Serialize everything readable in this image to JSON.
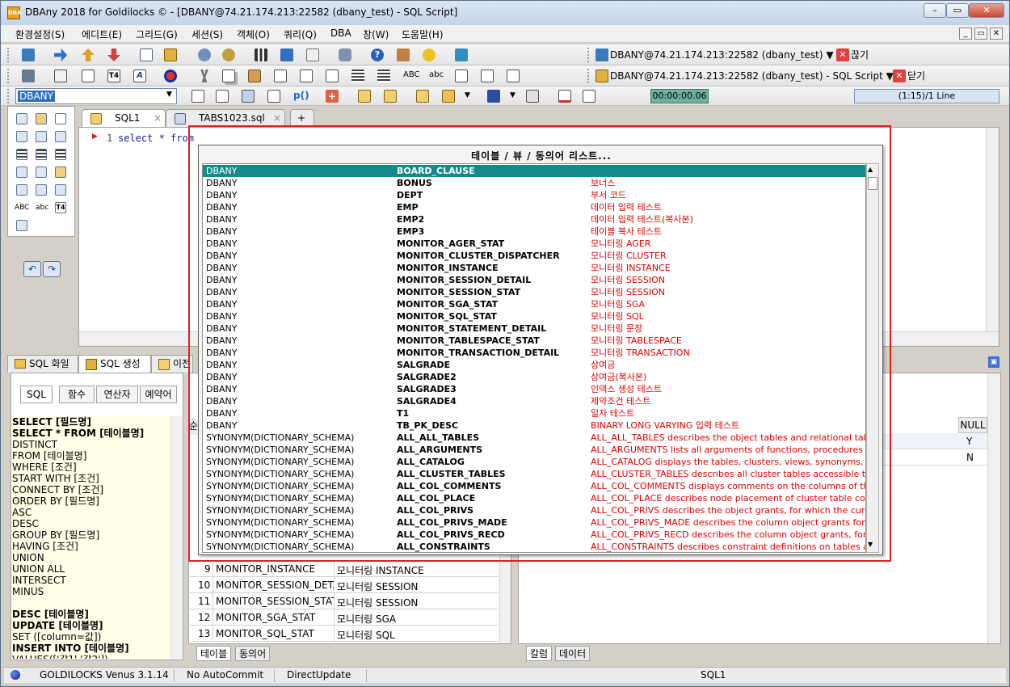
{
  "window": {
    "title": "DBAny 2018 for Goldilocks © - [DBANY@74.21.174.213:22582 (dbany_test) - SQL Script]",
    "icon_text": "DBA"
  },
  "menu": [
    "환경설정(S)",
    "에디트(E)",
    "그리드(G)",
    "세션(S)",
    "객체(O)",
    "쿼리(Q)",
    "DBA",
    "창(W)",
    "도움말(H)"
  ],
  "toolbar": {
    "connection1": "DBANY@74.21.174.213:22582 (dbany_test) ▼",
    "disconnect": "끊기",
    "connection2": "DBANY@74.21.174.213:22582 (dbany_test) - SQL Script ▼",
    "close": "닫기",
    "schema": "DBANY",
    "abc_upper": "ABC",
    "abc_lower": "abc",
    "timer": "00:00:00.06",
    "position": "(1:15)/1 Line"
  },
  "editor": {
    "tabs": [
      "SQL1",
      "TABS1023.sql"
    ],
    "line_no": "1",
    "code": "select * from "
  },
  "left_tools": {
    "abc_upper": "ABC",
    "abc_lower": "abc"
  },
  "bottom_tabs": [
    "SQL 화일",
    "SQL 생성",
    "이전"
  ],
  "sql_subtabs": [
    "SQL",
    "함수",
    "연산자",
    "예약어"
  ],
  "sql_keywords": [
    {
      "t": "SELECT [필드명]",
      "b": true
    },
    {
      "t": "SELECT * FROM [테이블명]",
      "b": true
    },
    {
      "t": " DISTINCT",
      "b": false
    },
    {
      "t": " FROM [테이블명]",
      "b": false
    },
    {
      "t": " WHERE [조건]",
      "b": false
    },
    {
      "t": "  START WITH [조건]",
      "b": false
    },
    {
      "t": "  CONNECT BY [조건]",
      "b": false
    },
    {
      "t": " ORDER BY [필드명]",
      "b": false
    },
    {
      "t": "  ASC",
      "b": false
    },
    {
      "t": "  DESC",
      "b": false
    },
    {
      "t": " GROUP BY [필드명]",
      "b": false
    },
    {
      "t": "  HAVING [조건]",
      "b": false
    },
    {
      "t": " UNION",
      "b": false
    },
    {
      "t": " UNION ALL",
      "b": false
    },
    {
      "t": " INTERSECT",
      "b": false
    },
    {
      "t": " MINUS",
      "b": false
    },
    {
      "t": "",
      "b": false
    },
    {
      "t": "DESC [테이블명]",
      "b": true
    },
    {
      "t": "UPDATE [테이블명]",
      "b": true
    },
    {
      "t": " SET ([column=값])",
      "b": false
    },
    {
      "t": "INSERT INTO [테이블명]",
      "b": true
    },
    {
      "t": " VALUES(['값1' '값2'])",
      "b": false
    }
  ],
  "grid_rows": [
    {
      "n": "9",
      "name": "MONITOR_INSTANCE",
      "desc": "모니터링 INSTANCE"
    },
    {
      "n": "10",
      "name": "MONITOR_SESSION_DETAI",
      "desc": "모니터링 SESSION"
    },
    {
      "n": "11",
      "name": "MONITOR_SESSION_STAT",
      "desc": "모니터링 SESSION"
    },
    {
      "n": "12",
      "name": "MONITOR_SGA_STAT",
      "desc": "모니터링 SGA"
    },
    {
      "n": "13",
      "name": "MONITOR_SQL_STAT",
      "desc": "모니터링 SQL"
    }
  ],
  "mid_bottom_tabs": [
    "테이블",
    "동의어"
  ],
  "right_panel": {
    "null_header": "NULL",
    "null_values": [
      "Y",
      "N"
    ],
    "bottom_tabs": [
      "칼럼",
      "데이터"
    ],
    "col_header_left": "순"
  },
  "status": {
    "db": "GOLDILOCKS Venus 3.1.14",
    "commit": "No AutoCommit",
    "update": "DirectUpdate",
    "script": "SQL1"
  },
  "popup": {
    "title": "테이블 / 뷰 / 동의어 리스트...",
    "rows": [
      {
        "schema": "DBANY",
        "name": "BOARD_CLAUSE",
        "desc": ""
      },
      {
        "schema": "DBANY",
        "name": "BONUS",
        "desc": "보너스"
      },
      {
        "schema": "DBANY",
        "name": "DEPT",
        "desc": "부서 코드"
      },
      {
        "schema": "DBANY",
        "name": "EMP",
        "desc": "데이터 입력 테스트"
      },
      {
        "schema": "DBANY",
        "name": "EMP2",
        "desc": "데이터 입력 테스트(복사본)"
      },
      {
        "schema": "DBANY",
        "name": "EMP3",
        "desc": "테이블 복사 테스트"
      },
      {
        "schema": "DBANY",
        "name": "MONITOR_AGER_STAT",
        "desc": "모니터링 AGER"
      },
      {
        "schema": "DBANY",
        "name": "MONITOR_CLUSTER_DISPATCHER",
        "desc": "모니터링 CLUSTER"
      },
      {
        "schema": "DBANY",
        "name": "MONITOR_INSTANCE",
        "desc": "모니터링 INSTANCE"
      },
      {
        "schema": "DBANY",
        "name": "MONITOR_SESSION_DETAIL",
        "desc": "모니터링 SESSION"
      },
      {
        "schema": "DBANY",
        "name": "MONITOR_SESSION_STAT",
        "desc": "모니터링 SESSION"
      },
      {
        "schema": "DBANY",
        "name": "MONITOR_SGA_STAT",
        "desc": "모니터링 SGA"
      },
      {
        "schema": "DBANY",
        "name": "MONITOR_SQL_STAT",
        "desc": "모니터링 SQL"
      },
      {
        "schema": "DBANY",
        "name": "MONITOR_STATEMENT_DETAIL",
        "desc": "모니터링 문장"
      },
      {
        "schema": "DBANY",
        "name": "MONITOR_TABLESPACE_STAT",
        "desc": "모니터링 TABLESPACE"
      },
      {
        "schema": "DBANY",
        "name": "MONITOR_TRANSACTION_DETAIL",
        "desc": "모니터링 TRANSACTION"
      },
      {
        "schema": "DBANY",
        "name": "SALGRADE",
        "desc": "상여금"
      },
      {
        "schema": "DBANY",
        "name": "SALGRADE2",
        "desc": "상여금(복사본)"
      },
      {
        "schema": "DBANY",
        "name": "SALGRADE3",
        "desc": "인덱스 생성 테스트"
      },
      {
        "schema": "DBANY",
        "name": "SALGRADE4",
        "desc": "제약조건 테스트"
      },
      {
        "schema": "DBANY",
        "name": "T1",
        "desc": "일자 테스트"
      },
      {
        "schema": "DBANY",
        "name": "TB_PK_DESC",
        "desc": "BINARY LONG VARYING 입력 테스트"
      },
      {
        "schema": "SYNONYM(DICTIONARY_SCHEMA)",
        "name": "ALL_ALL_TABLES",
        "desc": "ALL_ALL_TABLES describes the object tables and relational tables accessible"
      },
      {
        "schema": "SYNONYM(DICTIONARY_SCHEMA)",
        "name": "ALL_ARGUMENTS",
        "desc": "ALL_ARGUMENTS lists all arguments of functions, procedures"
      },
      {
        "schema": "SYNONYM(DICTIONARY_SCHEMA)",
        "name": "ALL_CATALOG",
        "desc": "ALL_CATALOG displays the tables, clusters, views, synonyms, and sequences"
      },
      {
        "schema": "SYNONYM(DICTIONARY_SCHEMA)",
        "name": "ALL_CLUSTER_TABLES",
        "desc": "ALL_CLUSTER_TABLES describes all cluster tables accessible to the current user"
      },
      {
        "schema": "SYNONYM(DICTIONARY_SCHEMA)",
        "name": "ALL_COL_COMMENTS",
        "desc": "ALL_COL_COMMENTS displays comments on the columns of the tables and views"
      },
      {
        "schema": "SYNONYM(DICTIONARY_SCHEMA)",
        "name": "ALL_COL_PLACE",
        "desc": "ALL_COL_PLACE describes node placement of cluster table columns accessible"
      },
      {
        "schema": "SYNONYM(DICTIONARY_SCHEMA)",
        "name": "ALL_COL_PRIVS",
        "desc": "ALL_COL_PRIVS describes the object grants, for which the current user"
      },
      {
        "schema": "SYNONYM(DICTIONARY_SCHEMA)",
        "name": "ALL_COL_PRIVS_MADE",
        "desc": "ALL_COL_PRIVS_MADE describes the column object grants for which the"
      },
      {
        "schema": "SYNONYM(DICTIONARY_SCHEMA)",
        "name": "ALL_COL_PRIVS_RECD",
        "desc": "ALL_COL_PRIVS_RECD describes the column object grants, for which the"
      },
      {
        "schema": "SYNONYM(DICTIONARY_SCHEMA)",
        "name": "ALL_CONSTRAINTS",
        "desc": "ALL_CONSTRAINTS describes constraint definitions on tables accessible"
      }
    ]
  },
  "colors": {
    "accent_red": "#e00000",
    "selected_row": "#148a8a",
    "highlight_box": "#e02020"
  }
}
